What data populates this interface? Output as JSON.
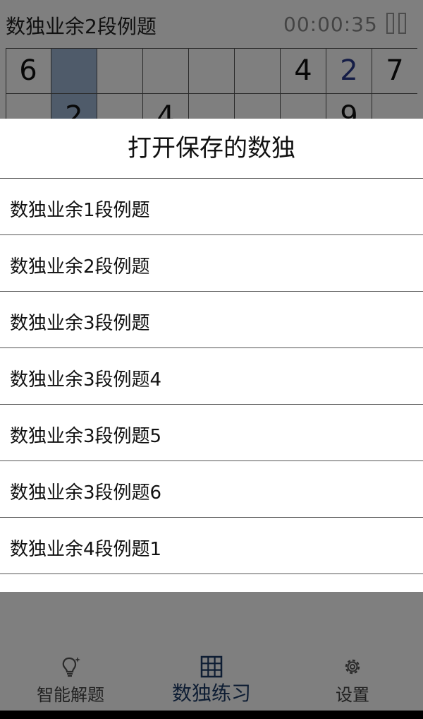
{
  "header": {
    "title": "数独业余2段例题",
    "timer": "00:00:35"
  },
  "grid": {
    "row1": [
      "6",
      "",
      "",
      "",
      "",
      "",
      "4",
      "2",
      "7"
    ],
    "row2": [
      "",
      "2",
      "",
      "4",
      "",
      "",
      "",
      "9",
      ""
    ]
  },
  "dialog": {
    "title": "打开保存的数独",
    "items": [
      "数独业余1段例题",
      "数独业余2段例题",
      "数独业余3段例题",
      "数独业余3段例题4",
      "数独业余3段例题5",
      "数独业余3段例题6",
      "数独业余4段例题1"
    ]
  },
  "nav": {
    "items": [
      {
        "label": "智能解题",
        "icon": "lightbulb-icon"
      },
      {
        "label": "数独练习",
        "icon": "grid-icon"
      },
      {
        "label": "设置",
        "icon": "gear-icon"
      }
    ]
  }
}
